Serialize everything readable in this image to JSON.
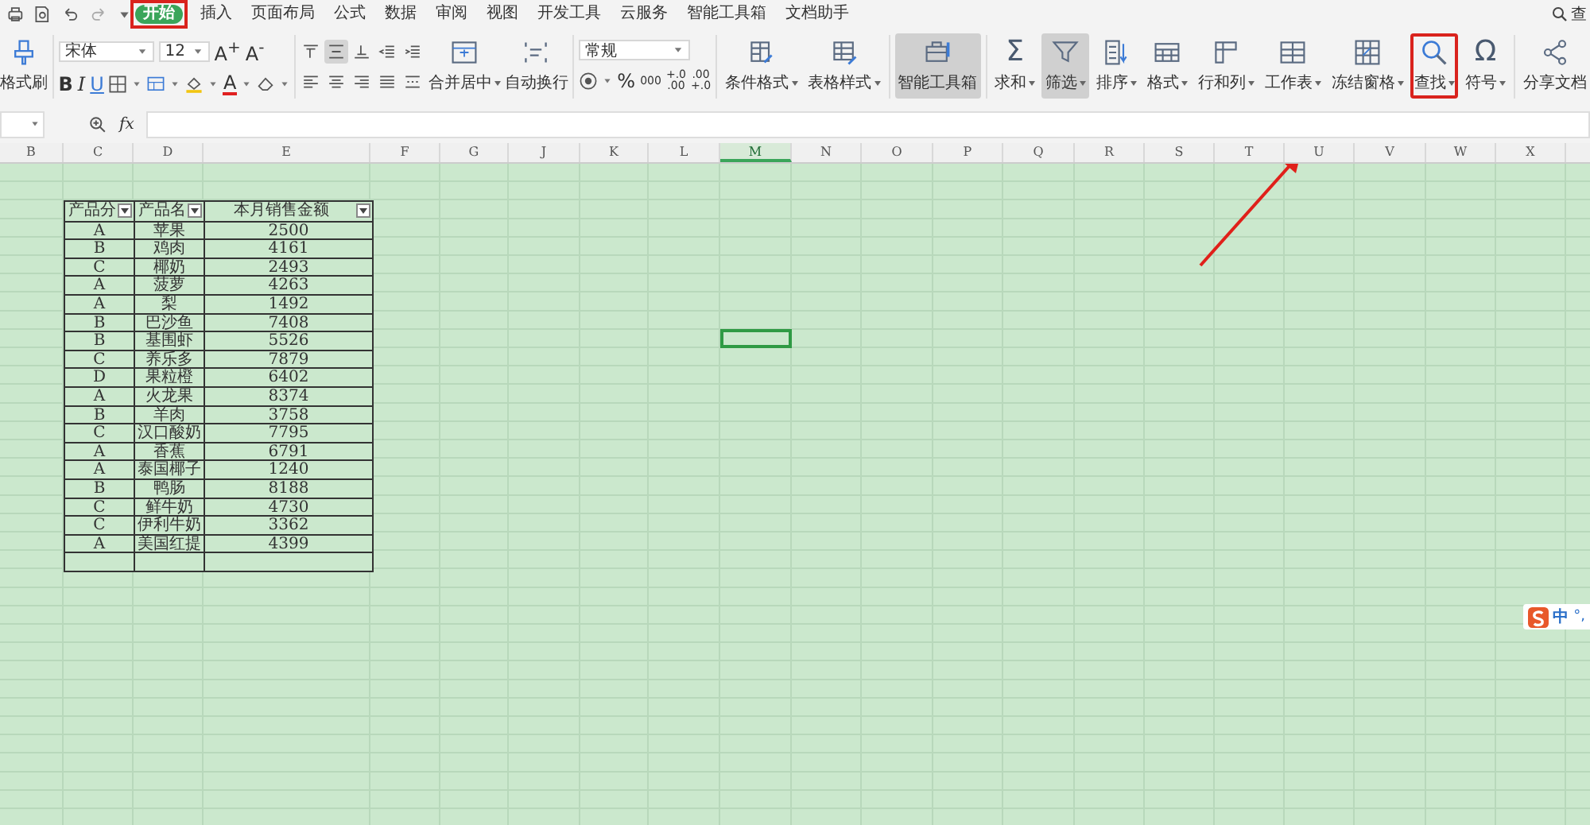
{
  "menu_tabs": [
    {
      "label": "开始",
      "selected": true,
      "highlighted": true
    },
    {
      "label": "插入",
      "selected": false,
      "highlighted": false
    },
    {
      "label": "页面布局",
      "selected": false,
      "highlighted": false
    },
    {
      "label": "公式",
      "selected": false,
      "highlighted": false
    },
    {
      "label": "数据",
      "selected": false,
      "highlighted": false
    },
    {
      "label": "审阅",
      "selected": false,
      "highlighted": false
    },
    {
      "label": "视图",
      "selected": false,
      "highlighted": false
    },
    {
      "label": "开发工具",
      "selected": false,
      "highlighted": false
    },
    {
      "label": "云服务",
      "selected": false,
      "highlighted": false
    },
    {
      "label": "智能工具箱",
      "selected": false,
      "highlighted": false
    },
    {
      "label": "文档助手",
      "selected": false,
      "highlighted": false
    }
  ],
  "menu_search": {
    "label": "查"
  },
  "ribbon": {
    "format_painter": {
      "label": "格式刷"
    },
    "font": {
      "name": "宋体",
      "size": "12",
      "grow": "A$^{+}$",
      "shrink": "A$^{-}$",
      "styles": [
        "B",
        "I",
        "U"
      ],
      "font_color": "A"
    },
    "alignment": [
      {
        "selected": false
      },
      {
        "selected": true
      },
      {
        "selected": false
      },
      {
        "selected": false
      },
      {
        "selected": false
      },
      {
        "selected": false
      },
      {
        "selected": false
      },
      {
        "selected": false
      },
      {
        "selected": false
      },
      {
        "selected": false
      }
    ],
    "merge": [
      {
        "label": "合并居中",
        "dropdown": true
      },
      {
        "label": "自动换行",
        "dropdown": false
      }
    ],
    "number": {
      "format": "常规",
      "percent": "%",
      "thousands": "000",
      "decimals": [
        {
          "top": "+.0",
          "bottom": ".00"
        },
        {
          "top": ".00",
          "bottom": "+.0"
        }
      ]
    },
    "tool_groups": [
      [
        {
          "label": "条件格式",
          "dropdown": true,
          "selected": false,
          "highlighted": false
        },
        {
          "label": "表格样式",
          "dropdown": true,
          "selected": false,
          "highlighted": false
        }
      ],
      [
        {
          "label": "智能工具箱",
          "dropdown": false,
          "selected": true,
          "highlighted": false
        }
      ],
      [
        {
          "label": "求和",
          "glyph": "Σ",
          "dropdown": true,
          "selected": false,
          "highlighted": false
        },
        {
          "label": "筛选",
          "dropdown": true,
          "selected": true,
          "highlighted": false
        },
        {
          "label": "排序",
          "dropdown": true,
          "selected": false,
          "highlighted": false
        },
        {
          "label": "格式",
          "dropdown": true,
          "selected": false,
          "highlighted": false
        },
        {
          "label": "行和列",
          "dropdown": true,
          "selected": false,
          "highlighted": false
        },
        {
          "label": "工作表",
          "dropdown": true,
          "selected": false,
          "highlighted": false
        },
        {
          "label": "冻结窗格",
          "dropdown": true,
          "selected": false,
          "highlighted": false
        },
        {
          "label": "查找",
          "dropdown": true,
          "selected": false,
          "highlighted": true
        },
        {
          "label": "符号",
          "glyph": "Ω",
          "dropdown": true,
          "selected": false,
          "highlighted": false
        }
      ],
      [
        {
          "label": "分享文档",
          "dropdown": false,
          "selected": false,
          "highlighted": false
        }
      ]
    ]
  },
  "formula_bar": {
    "fx": "fx"
  },
  "column_headers": [
    {
      "label": "B",
      "selected": false
    },
    {
      "label": "C",
      "selected": false
    },
    {
      "label": "D",
      "selected": false
    },
    {
      "label": "E",
      "selected": false
    },
    {
      "label": "F",
      "selected": false
    },
    {
      "label": "G",
      "selected": false
    },
    {
      "label": "J",
      "selected": false
    },
    {
      "label": "K",
      "selected": false
    },
    {
      "label": "L",
      "selected": false
    },
    {
      "label": "M",
      "selected": true
    },
    {
      "label": "N",
      "selected": false
    },
    {
      "label": "O",
      "selected": false
    },
    {
      "label": "P",
      "selected": false
    },
    {
      "label": "Q",
      "selected": false
    },
    {
      "label": "R",
      "selected": false
    },
    {
      "label": "S",
      "selected": false
    },
    {
      "label": "T",
      "selected": false
    },
    {
      "label": "U",
      "selected": false
    },
    {
      "label": "V",
      "selected": false
    },
    {
      "label": "W",
      "selected": false
    },
    {
      "label": "X",
      "selected": false
    }
  ],
  "table": {
    "columns": [
      {
        "label": "产品分",
        "filter": true
      },
      {
        "label": "产品名",
        "filter": true
      },
      {
        "label": "本月销售金额",
        "filter": true
      }
    ],
    "rows": [
      [
        "A",
        "苹果",
        "2500"
      ],
      [
        "B",
        "鸡肉",
        "4161"
      ],
      [
        "C",
        "椰奶",
        "2493"
      ],
      [
        "A",
        "菠萝",
        "4263"
      ],
      [
        "A",
        "梨",
        "1492"
      ],
      [
        "B",
        "巴沙鱼",
        "7408"
      ],
      [
        "B",
        "基围虾",
        "5526"
      ],
      [
        "C",
        "养乐多",
        "7879"
      ],
      [
        "D",
        "果粒橙",
        "6402"
      ],
      [
        "A",
        "火龙果",
        "8374"
      ],
      [
        "B",
        "羊肉",
        "3758"
      ],
      [
        "C",
        "汉口酸奶",
        "7795"
      ],
      [
        "A",
        "香蕉",
        "6791"
      ],
      [
        "A",
        "泰国椰子",
        "1240"
      ],
      [
        "B",
        "鸭肠",
        "8188"
      ],
      [
        "C",
        "鲜牛奶",
        "4730"
      ],
      [
        "C",
        "伊利牛奶",
        "3362"
      ],
      [
        "A",
        "美国红提",
        "4399"
      ]
    ]
  },
  "ime": {
    "mode": "中",
    "punct": "°,"
  }
}
